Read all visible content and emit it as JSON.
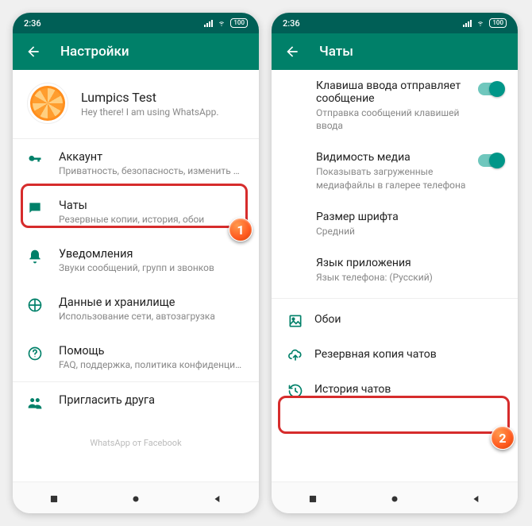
{
  "status": {
    "time": "2:36",
    "battery": "100"
  },
  "left": {
    "header": "Настройки",
    "profile": {
      "name": "Lumpics Test",
      "status": "Hey there! I am using WhatsApp."
    },
    "items": [
      {
        "title": "Аккаунт",
        "sub": "Приватность, безопасность, изменить номер"
      },
      {
        "title": "Чаты",
        "sub": "Резервные копии, история, обои"
      },
      {
        "title": "Уведомления",
        "sub": "Звуки сообщений, групп и звонков"
      },
      {
        "title": "Данные и хранилище",
        "sub": "Использование сети, автозагрузка"
      },
      {
        "title": "Помощь",
        "sub": "FAQ, поддержка, политика конфиденциал..."
      },
      {
        "title": "Пригласить друга",
        "sub": ""
      }
    ],
    "footer": "WhatsApp от Facebook"
  },
  "right": {
    "header": "Чаты",
    "rows": [
      {
        "title": "Клавиша ввода отправляет сообщение",
        "sub": "Отправка сообщений клавишей ввода",
        "toggle": true
      },
      {
        "title": "Видимость медиа",
        "sub": "Показывать загруженные медиафайлы в галерее телефона",
        "toggle": true
      },
      {
        "title": "Размер шрифта",
        "sub": "Средний"
      },
      {
        "title": "Язык приложения",
        "sub": "Язык телефона: (Русский)"
      }
    ],
    "actions": [
      {
        "title": "Обои"
      },
      {
        "title": "Резервная копия чатов"
      },
      {
        "title": "История чатов"
      }
    ]
  },
  "badges": {
    "one": "1",
    "two": "2"
  }
}
